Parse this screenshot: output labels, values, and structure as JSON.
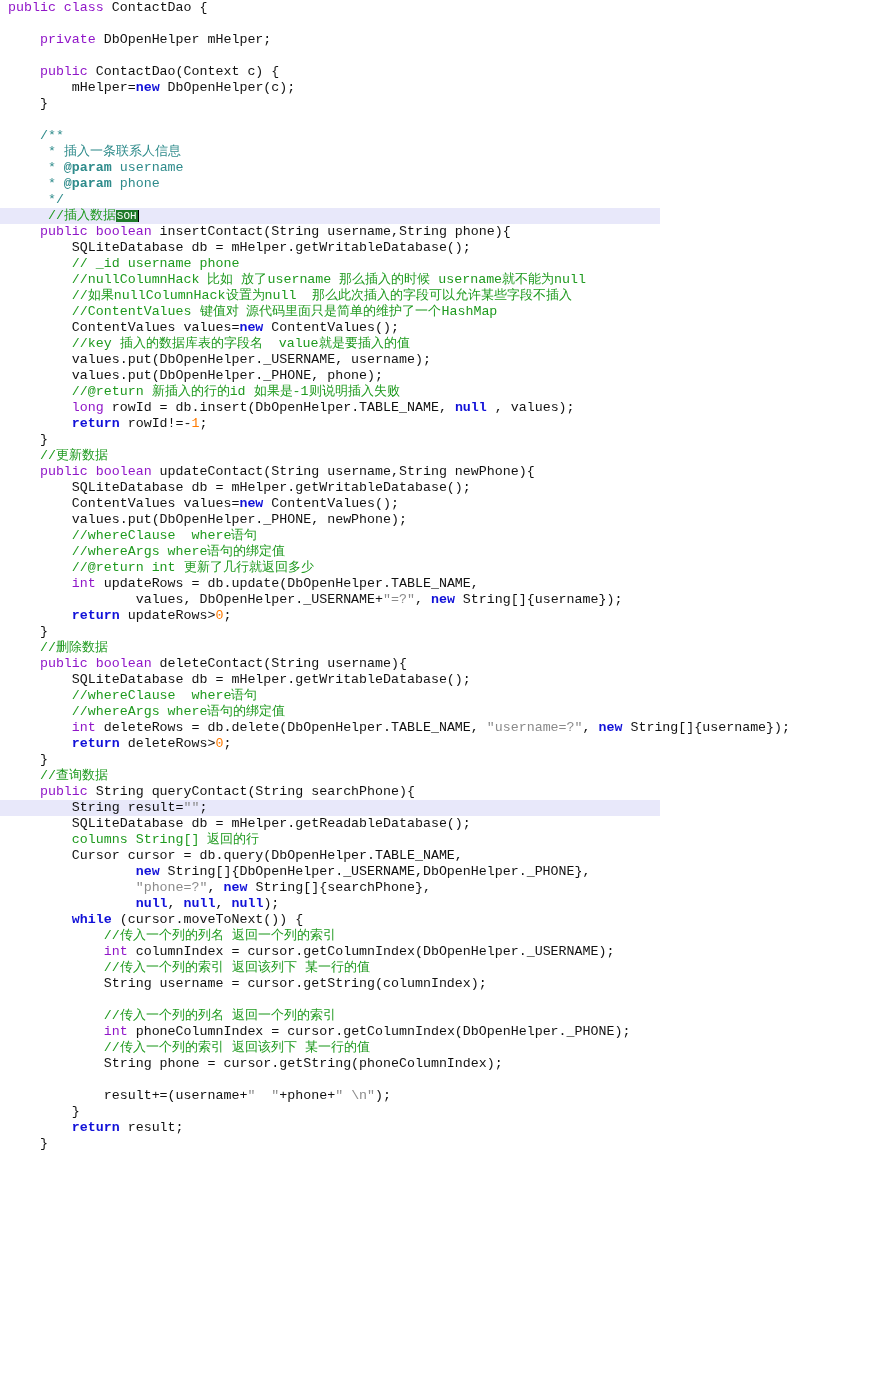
{
  "editor": {
    "lines": [
      {
        "highlighted": false,
        "tokens": [
          {
            "kind": "keyword",
            "text": "public"
          },
          {
            "kind": "keyword",
            "text": " class"
          },
          {
            "kind": "plain",
            "text": " ContactDao {"
          }
        ]
      },
      {
        "highlighted": false
      },
      {
        "highlighted": false,
        "tokens": [
          {
            "kind": "keyword",
            "text": "    private"
          },
          {
            "kind": "plain",
            "text": " DbOpenHelper mHelper;"
          }
        ]
      },
      {
        "highlighted": false
      },
      {
        "highlighted": false,
        "tokens": [
          {
            "kind": "keyword",
            "text": "    public"
          },
          {
            "kind": "plain",
            "text": " ContactDao(Context c) {"
          }
        ]
      },
      {
        "highlighted": false,
        "tokens": [
          {
            "kind": "plain",
            "text": "        mHelper="
          },
          {
            "kind": "operator",
            "text": "new"
          },
          {
            "kind": "plain",
            "text": " DbOpenHelper(c);"
          }
        ]
      },
      {
        "highlighted": false,
        "tokens": [
          {
            "kind": "plain",
            "text": "    }"
          }
        ]
      },
      {
        "highlighted": false
      },
      {
        "highlighted": false,
        "tokens": [
          {
            "kind": "doc",
            "text": "    /**"
          }
        ]
      },
      {
        "highlighted": false,
        "tokens": [
          {
            "kind": "doc",
            "text": "     * 插入一条联系人信息"
          }
        ]
      },
      {
        "highlighted": false,
        "tokens": [
          {
            "kind": "doc",
            "text": "     * "
          },
          {
            "kind": "doctag",
            "text": "@param"
          },
          {
            "kind": "doc",
            "text": " username"
          }
        ]
      },
      {
        "highlighted": false,
        "tokens": [
          {
            "kind": "doc",
            "text": "     * "
          },
          {
            "kind": "doctag",
            "text": "@param"
          },
          {
            "kind": "doc",
            "text": " phone"
          }
        ]
      },
      {
        "highlighted": false,
        "tokens": [
          {
            "kind": "doc",
            "text": "     */"
          }
        ]
      },
      {
        "highlighted": true,
        "tokens": [
          {
            "kind": "comment",
            "text": "     //插入数据"
          },
          {
            "kind": "control",
            "text": "SOH"
          }
        ]
      },
      {
        "highlighted": false,
        "tokens": [
          {
            "kind": "keyword",
            "text": "    public"
          },
          {
            "kind": "keyword",
            "text": " boolean"
          },
          {
            "kind": "plain",
            "text": " insertContact(String username,String phone){"
          }
        ]
      },
      {
        "highlighted": false,
        "tokens": [
          {
            "kind": "plain",
            "text": "        SQLiteDatabase db = mHelper.getWritableDatabase();"
          }
        ]
      },
      {
        "highlighted": false,
        "tokens": [
          {
            "kind": "comment",
            "text": "        // _id username phone"
          }
        ]
      },
      {
        "highlighted": false,
        "tokens": [
          {
            "kind": "comment",
            "text": "        //nullColumnHack 比如 放了username 那么插入的时候 username就不能为null"
          }
        ]
      },
      {
        "highlighted": false,
        "tokens": [
          {
            "kind": "comment",
            "text": "        //如果nullColumnHack设置为null  那么此次插入的字段可以允许某些字段不插入"
          }
        ]
      },
      {
        "highlighted": false,
        "tokens": [
          {
            "kind": "comment",
            "text": "        //ContentValues 键值对 源代码里面只是简单的维护了一个HashMap"
          }
        ]
      },
      {
        "highlighted": false,
        "tokens": [
          {
            "kind": "plain",
            "text": "        ContentValues values="
          },
          {
            "kind": "operator",
            "text": "new"
          },
          {
            "kind": "plain",
            "text": " ContentValues();"
          }
        ]
      },
      {
        "highlighted": false,
        "tokens": [
          {
            "kind": "comment",
            "text": "        //key 插入的数据库表的字段名  value就是要插入的值"
          }
        ]
      },
      {
        "highlighted": false,
        "tokens": [
          {
            "kind": "plain",
            "text": "        values.put(DbOpenHelper._USERNAME, username);"
          }
        ]
      },
      {
        "highlighted": false,
        "tokens": [
          {
            "kind": "plain",
            "text": "        values.put(DbOpenHelper._PHONE, phone);"
          }
        ]
      },
      {
        "highlighted": false,
        "tokens": [
          {
            "kind": "comment",
            "text": "        //@return 新插入的行的id 如果是-1则说明插入失败"
          }
        ]
      },
      {
        "highlighted": false,
        "tokens": [
          {
            "kind": "keyword",
            "text": "        long"
          },
          {
            "kind": "plain",
            "text": " rowId = db.insert(DbOpenHelper.TABLE_NAME, "
          },
          {
            "kind": "operator",
            "text": "null"
          },
          {
            "kind": "plain",
            "text": " , values);"
          }
        ]
      },
      {
        "highlighted": false,
        "tokens": [
          {
            "kind": "operator",
            "text": "        return"
          },
          {
            "kind": "plain",
            "text": " rowId!=-"
          },
          {
            "kind": "number",
            "text": "1"
          },
          {
            "kind": "plain",
            "text": ";"
          }
        ]
      },
      {
        "highlighted": false,
        "tokens": [
          {
            "kind": "plain",
            "text": "    }"
          }
        ]
      },
      {
        "highlighted": false,
        "tokens": [
          {
            "kind": "comment",
            "text": "    //更新数据"
          }
        ]
      },
      {
        "highlighted": false,
        "tokens": [
          {
            "kind": "keyword",
            "text": "    public"
          },
          {
            "kind": "keyword",
            "text": " boolean"
          },
          {
            "kind": "plain",
            "text": " updateContact(String username,String newPhone){"
          }
        ]
      },
      {
        "highlighted": false,
        "tokens": [
          {
            "kind": "plain",
            "text": "        SQLiteDatabase db = mHelper.getWritableDatabase();"
          }
        ]
      },
      {
        "highlighted": false,
        "tokens": [
          {
            "kind": "plain",
            "text": "        ContentValues values="
          },
          {
            "kind": "operator",
            "text": "new"
          },
          {
            "kind": "plain",
            "text": " ContentValues();"
          }
        ]
      },
      {
        "highlighted": false,
        "tokens": [
          {
            "kind": "plain",
            "text": "        values.put(DbOpenHelper._PHONE, newPhone);"
          }
        ]
      },
      {
        "highlighted": false,
        "tokens": [
          {
            "kind": "comment",
            "text": "        //whereClause  where语句"
          }
        ]
      },
      {
        "highlighted": false,
        "tokens": [
          {
            "kind": "comment",
            "text": "        //whereArgs where语句的绑定值"
          }
        ]
      },
      {
        "highlighted": false,
        "tokens": [
          {
            "kind": "comment",
            "text": "        //@return int 更新了几行就返回多少"
          }
        ]
      },
      {
        "highlighted": false,
        "tokens": [
          {
            "kind": "keyword",
            "text": "        int"
          },
          {
            "kind": "plain",
            "text": " updateRows = db.update(DbOpenHelper.TABLE_NAME,"
          }
        ]
      },
      {
        "highlighted": false,
        "tokens": [
          {
            "kind": "plain",
            "text": "                values, DbOpenHelper._USERNAME+"
          },
          {
            "kind": "string",
            "text": "\"=?\""
          },
          {
            "kind": "plain",
            "text": ", "
          },
          {
            "kind": "operator",
            "text": "new"
          },
          {
            "kind": "plain",
            "text": " String[]{username});"
          }
        ]
      },
      {
        "highlighted": false,
        "tokens": [
          {
            "kind": "operator",
            "text": "        return"
          },
          {
            "kind": "plain",
            "text": " updateRows>"
          },
          {
            "kind": "number",
            "text": "0"
          },
          {
            "kind": "plain",
            "text": ";"
          }
        ]
      },
      {
        "highlighted": false,
        "tokens": [
          {
            "kind": "plain",
            "text": "    }"
          }
        ]
      },
      {
        "highlighted": false,
        "tokens": [
          {
            "kind": "comment",
            "text": "    //删除数据"
          }
        ]
      },
      {
        "highlighted": false,
        "tokens": [
          {
            "kind": "keyword",
            "text": "    public"
          },
          {
            "kind": "keyword",
            "text": " boolean"
          },
          {
            "kind": "plain",
            "text": " deleteContact(String username){"
          }
        ]
      },
      {
        "highlighted": false,
        "tokens": [
          {
            "kind": "plain",
            "text": "        SQLiteDatabase db = mHelper.getWritableDatabase();"
          }
        ]
      },
      {
        "highlighted": false,
        "tokens": [
          {
            "kind": "comment",
            "text": "        //whereClause  where语句"
          }
        ]
      },
      {
        "highlighted": false,
        "tokens": [
          {
            "kind": "comment",
            "text": "        //whereArgs where语句的绑定值"
          }
        ]
      },
      {
        "highlighted": false,
        "tokens": [
          {
            "kind": "keyword",
            "text": "        int"
          },
          {
            "kind": "plain",
            "text": " deleteRows = db.delete(DbOpenHelper.TABLE_NAME, "
          },
          {
            "kind": "string",
            "text": "\"username=?\""
          },
          {
            "kind": "plain",
            "text": ", "
          },
          {
            "kind": "operator",
            "text": "new"
          },
          {
            "kind": "plain",
            "text": " String[]{username});"
          }
        ]
      },
      {
        "highlighted": false,
        "tokens": [
          {
            "kind": "operator",
            "text": "        return"
          },
          {
            "kind": "plain",
            "text": " deleteRows>"
          },
          {
            "kind": "number",
            "text": "0"
          },
          {
            "kind": "plain",
            "text": ";"
          }
        ]
      },
      {
        "highlighted": false,
        "tokens": [
          {
            "kind": "plain",
            "text": "    }"
          }
        ]
      },
      {
        "highlighted": false,
        "tokens": [
          {
            "kind": "comment",
            "text": "    //查询数据"
          }
        ]
      },
      {
        "highlighted": false,
        "tokens": [
          {
            "kind": "keyword",
            "text": "    public"
          },
          {
            "kind": "plain",
            "text": " String queryContact(String searchPhone){"
          }
        ]
      },
      {
        "highlighted": true,
        "tokens": [
          {
            "kind": "plain",
            "text": "        String result="
          },
          {
            "kind": "string",
            "text": "\"\""
          },
          {
            "kind": "plain",
            "text": ";"
          }
        ]
      },
      {
        "highlighted": false,
        "tokens": [
          {
            "kind": "plain",
            "text": "        SQLiteDatabase db = mHelper.getReadableDatabase();"
          }
        ]
      },
      {
        "highlighted": false,
        "tokens": [
          {
            "kind": "comment",
            "text": "        columns String[] 返回的行"
          }
        ]
      },
      {
        "highlighted": false,
        "tokens": [
          {
            "kind": "plain",
            "text": "        Cursor cursor = db.query(DbOpenHelper.TABLE_NAME,"
          }
        ]
      },
      {
        "highlighted": false,
        "tokens": [
          {
            "kind": "operator",
            "text": "                new"
          },
          {
            "kind": "plain",
            "text": " String[]{DbOpenHelper._USERNAME,DbOpenHelper._PHONE},"
          }
        ]
      },
      {
        "highlighted": false,
        "tokens": [
          {
            "kind": "string",
            "text": "                \"phone=?\""
          },
          {
            "kind": "plain",
            "text": ", "
          },
          {
            "kind": "operator",
            "text": "new"
          },
          {
            "kind": "plain",
            "text": " String[]{searchPhone},"
          }
        ]
      },
      {
        "highlighted": false,
        "tokens": [
          {
            "kind": "operator",
            "text": "                null"
          },
          {
            "kind": "plain",
            "text": ", "
          },
          {
            "kind": "operator",
            "text": "null"
          },
          {
            "kind": "plain",
            "text": ", "
          },
          {
            "kind": "operator",
            "text": "null"
          },
          {
            "kind": "plain",
            "text": ");"
          }
        ]
      },
      {
        "highlighted": false,
        "tokens": [
          {
            "kind": "operator",
            "text": "        while"
          },
          {
            "kind": "plain",
            "text": " (cursor.moveToNext()) {"
          }
        ]
      },
      {
        "highlighted": false,
        "tokens": [
          {
            "kind": "comment",
            "text": "            //传入一个列的列名 返回一个列的索引"
          }
        ]
      },
      {
        "highlighted": false,
        "tokens": [
          {
            "kind": "keyword",
            "text": "            int"
          },
          {
            "kind": "plain",
            "text": " columnIndex = cursor.getColumnIndex(DbOpenHelper._USERNAME);"
          }
        ]
      },
      {
        "highlighted": false,
        "tokens": [
          {
            "kind": "comment",
            "text": "            //传入一个列的索引 返回该列下 某一行的值"
          }
        ]
      },
      {
        "highlighted": false,
        "tokens": [
          {
            "kind": "plain",
            "text": "            String username = cursor.getString(columnIndex);"
          }
        ]
      },
      {
        "highlighted": false
      },
      {
        "highlighted": false,
        "tokens": [
          {
            "kind": "comment",
            "text": "            //传入一个列的列名 返回一个列的索引"
          }
        ]
      },
      {
        "highlighted": false,
        "tokens": [
          {
            "kind": "keyword",
            "text": "            int"
          },
          {
            "kind": "plain",
            "text": " phoneColumnIndex = cursor.getColumnIndex(DbOpenHelper._PHONE);"
          }
        ]
      },
      {
        "highlighted": false,
        "tokens": [
          {
            "kind": "comment",
            "text": "            //传入一个列的索引 返回该列下 某一行的值"
          }
        ]
      },
      {
        "highlighted": false,
        "tokens": [
          {
            "kind": "plain",
            "text": "            String phone = cursor.getString(phoneColumnIndex);"
          }
        ]
      },
      {
        "highlighted": false
      },
      {
        "highlighted": false,
        "tokens": [
          {
            "kind": "plain",
            "text": "            result+=(username+"
          },
          {
            "kind": "string",
            "text": "\"  \""
          },
          {
            "kind": "plain",
            "text": "+phone+"
          },
          {
            "kind": "string",
            "text": "\" \\n\""
          },
          {
            "kind": "plain",
            "text": ");"
          }
        ]
      },
      {
        "highlighted": false,
        "tokens": [
          {
            "kind": "plain",
            "text": "        }"
          }
        ]
      },
      {
        "highlighted": false,
        "tokens": [
          {
            "kind": "operator",
            "text": "        return"
          },
          {
            "kind": "plain",
            "text": " result;"
          }
        ]
      },
      {
        "highlighted": false,
        "tokens": [
          {
            "kind": "plain",
            "text": "    }"
          }
        ]
      }
    ]
  }
}
